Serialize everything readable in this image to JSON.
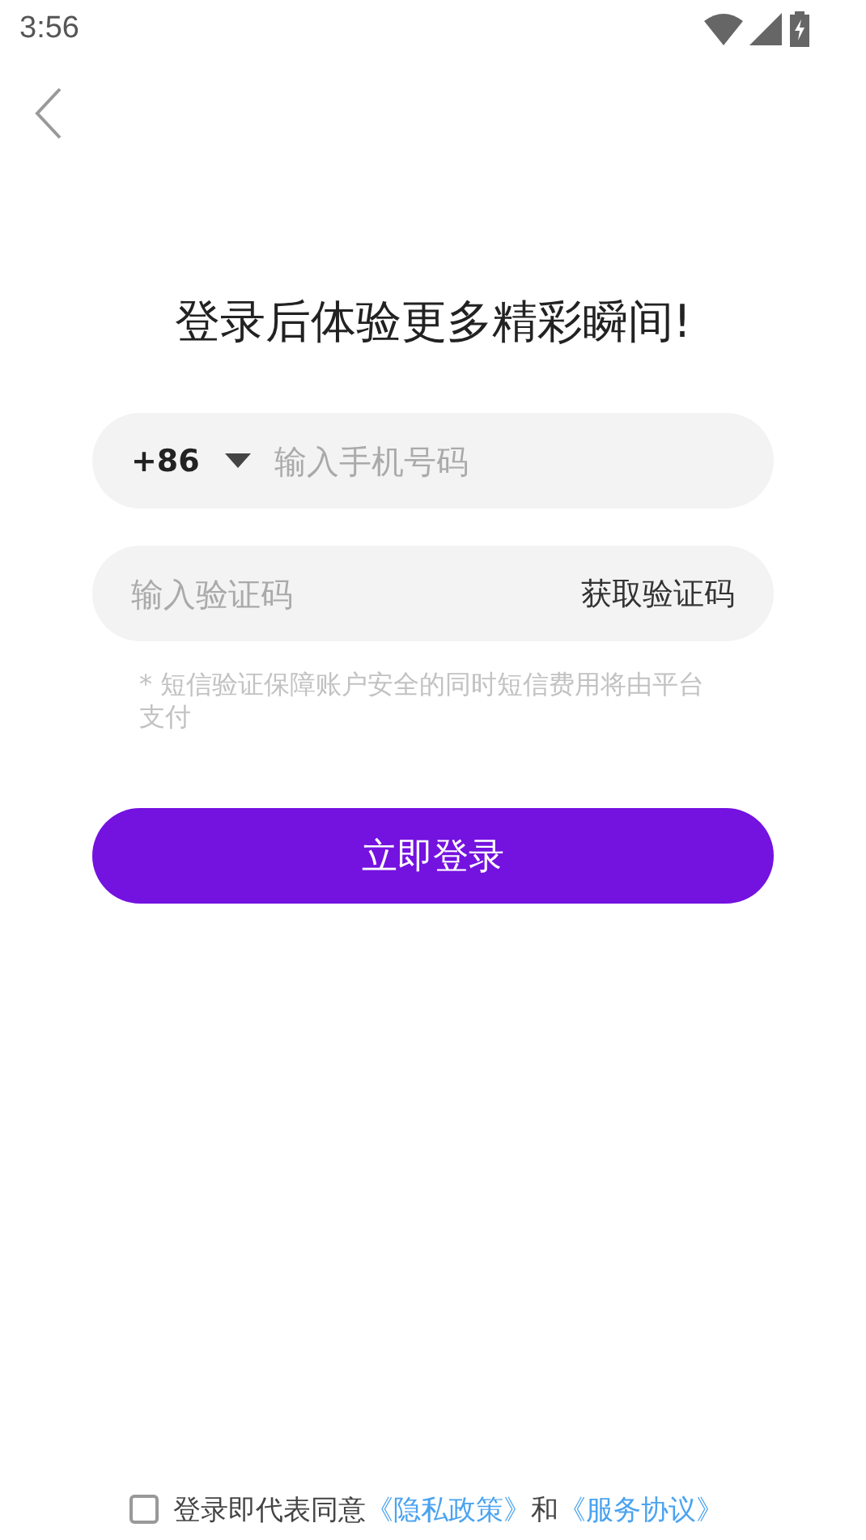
{
  "status_bar": {
    "time": "3:56"
  },
  "title": "登录后体验更多精彩瞬间!",
  "phone_field": {
    "country_code": "+86",
    "placeholder": "输入手机号码"
  },
  "code_field": {
    "placeholder": "输入验证码",
    "action": "获取验证码"
  },
  "hint": "* 短信验证保障账户安全的同时短信费用将由平台支付",
  "login_button": "立即登录",
  "agreement": {
    "checked": false,
    "parts": [
      {
        "kind": "text",
        "text": "登录即代表同意"
      },
      {
        "kind": "link",
        "text": "《隐私政策》"
      },
      {
        "kind": "text",
        "text": "和"
      },
      {
        "kind": "link",
        "text": "《服务协议》"
      }
    ]
  }
}
